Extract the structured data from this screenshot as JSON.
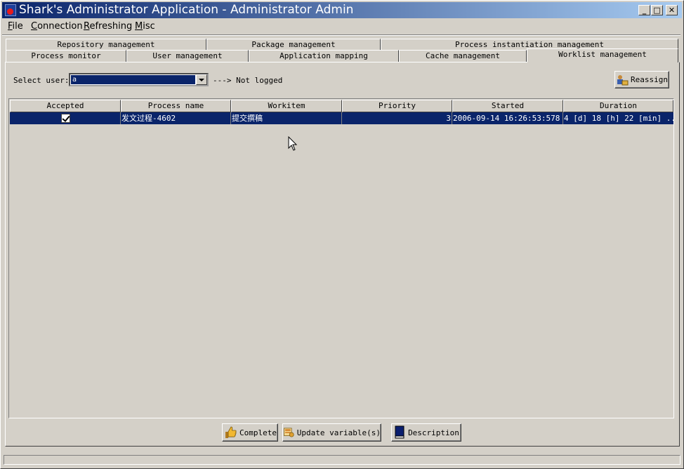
{
  "window": {
    "title": "Shark's Administrator Application - Administrator Admin",
    "controls": {
      "minimize": "_",
      "maximize": "□",
      "close": "✕"
    }
  },
  "menu": [
    {
      "label": "File",
      "mnemonic": "F",
      "rest": "ile"
    },
    {
      "label": "Connection",
      "mnemonic": "C",
      "rest": "onnection"
    },
    {
      "label": "Refreshing",
      "mnemonic": "R",
      "rest": "efreshing"
    },
    {
      "label": "Misc",
      "mnemonic": "M",
      "rest": "isc"
    }
  ],
  "tabs": {
    "row_back": [
      "Repository management",
      "Package management",
      "Process instantiation management"
    ],
    "row_front": [
      "Process monitor",
      "User management",
      "Application mapping",
      "Cache management",
      "Worklist management"
    ],
    "selected": "Worklist management"
  },
  "worklist": {
    "select_user_label": "Select user:",
    "selected_user": "a",
    "login_status": "---> Not logged",
    "reassign_label": "Reassign",
    "columns": [
      "Accepted",
      "Process name",
      "Workitem",
      "Priority",
      "Started",
      "Duration"
    ],
    "rows": [
      {
        "accepted": true,
        "process_name": "发文过程-4602",
        "workitem": "提交撰稿",
        "priority": "3",
        "started": "2006-09-14 16:26:53:578",
        "duration": "4 [d] 18 [h] 22 [min] ..."
      }
    ],
    "buttons": {
      "complete": "Complete",
      "update_variables": "Update variable(s)",
      "description": "Description"
    }
  },
  "colors": {
    "selection": "#0a246a",
    "face": "#d4d0c8",
    "title_start": "#0a246a",
    "title_end": "#a6caf0"
  },
  "icons": [
    "app-icon",
    "reassign-icon",
    "complete-thumbs-up-icon",
    "update-variables-icon",
    "description-book-icon",
    "mouse-cursor-icon"
  ]
}
